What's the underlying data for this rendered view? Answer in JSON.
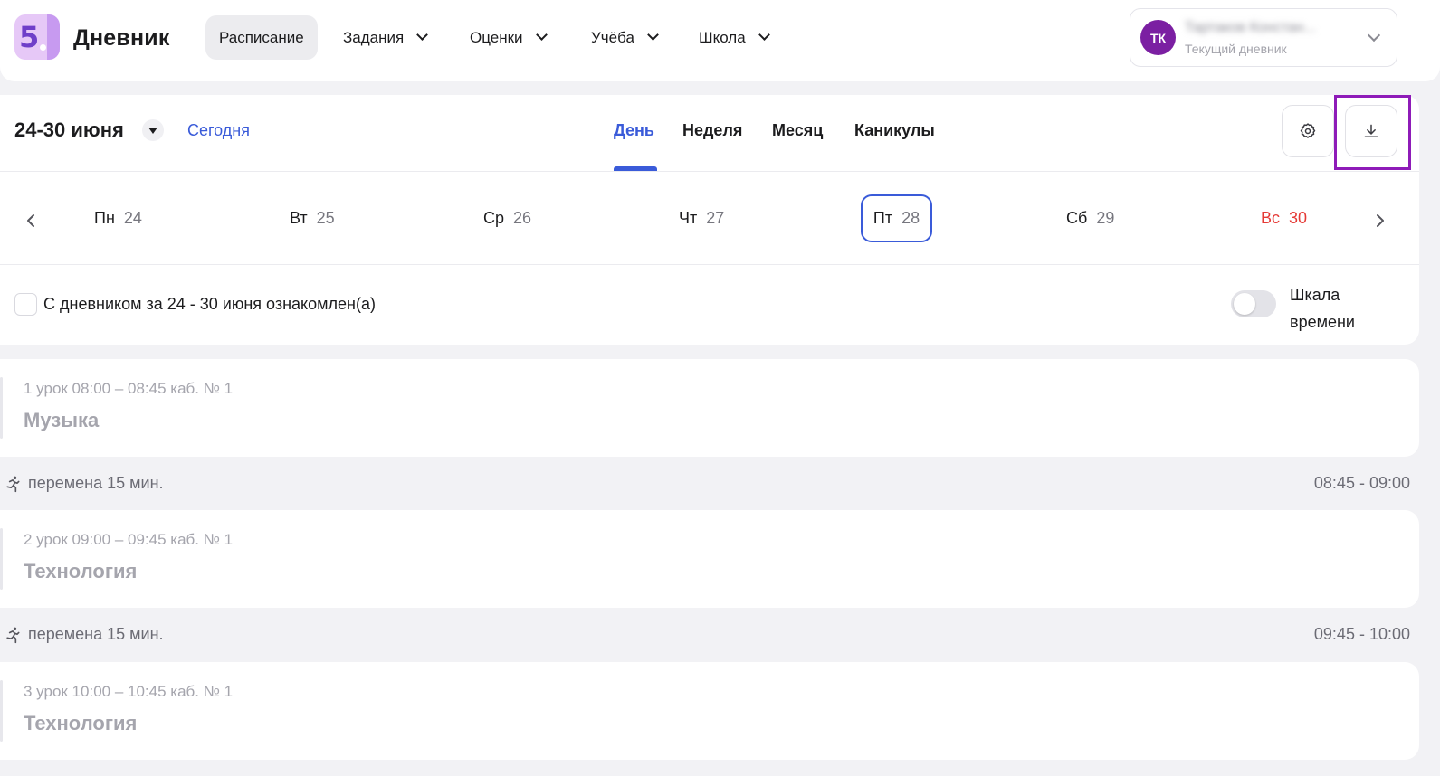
{
  "header": {
    "logo_digit": "5",
    "brand": "Дневник",
    "nav": [
      {
        "label": "Расписание"
      },
      {
        "label": "Задания"
      },
      {
        "label": "Оценки"
      },
      {
        "label": "Учёба"
      },
      {
        "label": "Школа"
      }
    ],
    "user": {
      "initials": "ТК",
      "name": "Тартаков Констан...",
      "subtitle": "Текущий дневник"
    }
  },
  "toolbar": {
    "range": "24-30 июня",
    "today": "Сегодня",
    "views": [
      "День",
      "Неделя",
      "Месяц",
      "Каникулы"
    ],
    "active_view": "День"
  },
  "days": [
    {
      "name": "Пн",
      "num": "24"
    },
    {
      "name": "Вт",
      "num": "25"
    },
    {
      "name": "Ср",
      "num": "26"
    },
    {
      "name": "Чт",
      "num": "27"
    },
    {
      "name": "Пт",
      "num": "28"
    },
    {
      "name": "Сб",
      "num": "29"
    },
    {
      "name": "Вс",
      "num": "30"
    }
  ],
  "acknowledge": {
    "label": "С дневником за 24 - 30 июня ознакомлен(а)"
  },
  "timeline_toggle": {
    "label_line1": "Шкала",
    "label_line2": "времени"
  },
  "lessons": [
    {
      "meta": "1 урок 08:00 – 08:45 каб. № 1",
      "subject": "Музыка"
    },
    {
      "meta": "2 урок 09:00 – 09:45 каб. № 1",
      "subject": "Технология"
    },
    {
      "meta": "3 урок 10:00 – 10:45 каб. № 1",
      "subject": "Технология"
    }
  ],
  "breaks": [
    {
      "text": "перемена 15 мин.",
      "time": "08:45 - 09:00"
    },
    {
      "text": "перемена 15 мин.",
      "time": "09:45 - 10:00"
    }
  ],
  "colors": {
    "accent": "#3a5bd9",
    "weekend": "#e53935",
    "avatar": "#7b1fa2",
    "highlight": "#8e1bb8"
  }
}
